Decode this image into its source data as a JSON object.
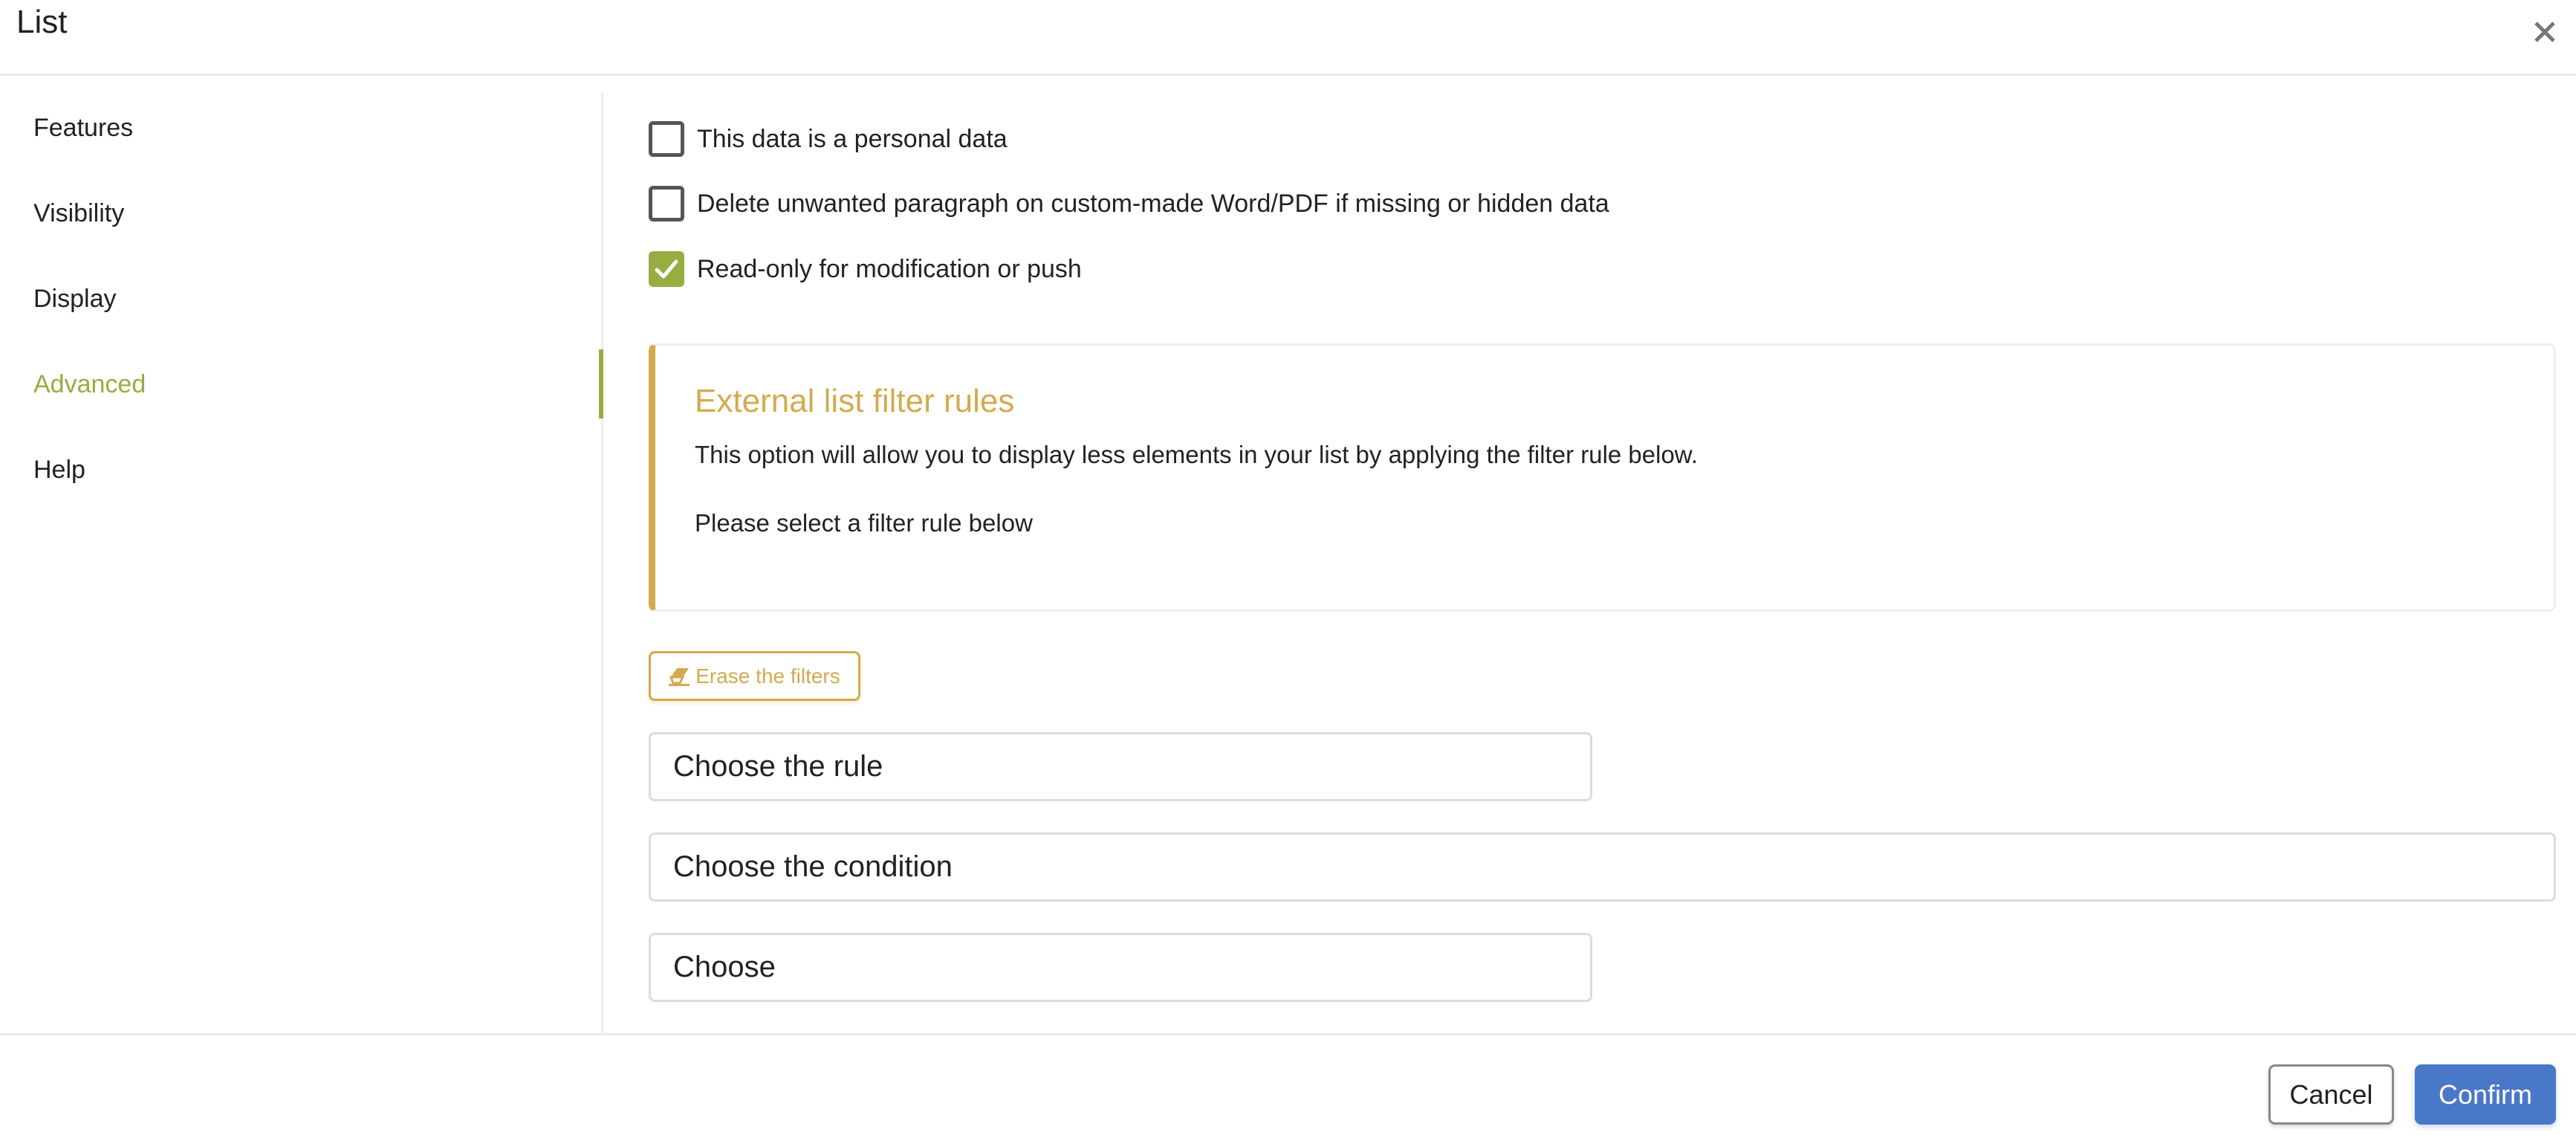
{
  "dialog": {
    "title": "List",
    "close_icon": "close-icon"
  },
  "sidebar": {
    "items": [
      {
        "label": "Features",
        "active": false
      },
      {
        "label": "Visibility",
        "active": false
      },
      {
        "label": "Display",
        "active": false
      },
      {
        "label": "Advanced",
        "active": true
      },
      {
        "label": "Help",
        "active": false
      }
    ]
  },
  "options": [
    {
      "label": "This data is a personal data",
      "checked": false
    },
    {
      "label": "Delete unwanted paragraph on custom-made Word/PDF if missing or hidden data",
      "checked": false
    },
    {
      "label": "Read-only for modification or push",
      "checked": true
    }
  ],
  "filter_section": {
    "title": "External list filter rules",
    "description": "This option will allow you to display less elements in your list by applying the filter rule below.",
    "hint": "Please select a filter rule below",
    "erase_button": {
      "label": "Erase the filters",
      "icon": "eraser-icon"
    },
    "selects": [
      {
        "value": "Choose the rule"
      },
      {
        "value": "Choose the condition"
      },
      {
        "value": "Choose"
      }
    ]
  },
  "footer": {
    "cancel_label": "Cancel",
    "confirm_label": "Confirm"
  },
  "colors": {
    "accent_green": "#97ad42",
    "accent_gold": "#d4aa4e",
    "primary_blue": "#4a78c8"
  }
}
